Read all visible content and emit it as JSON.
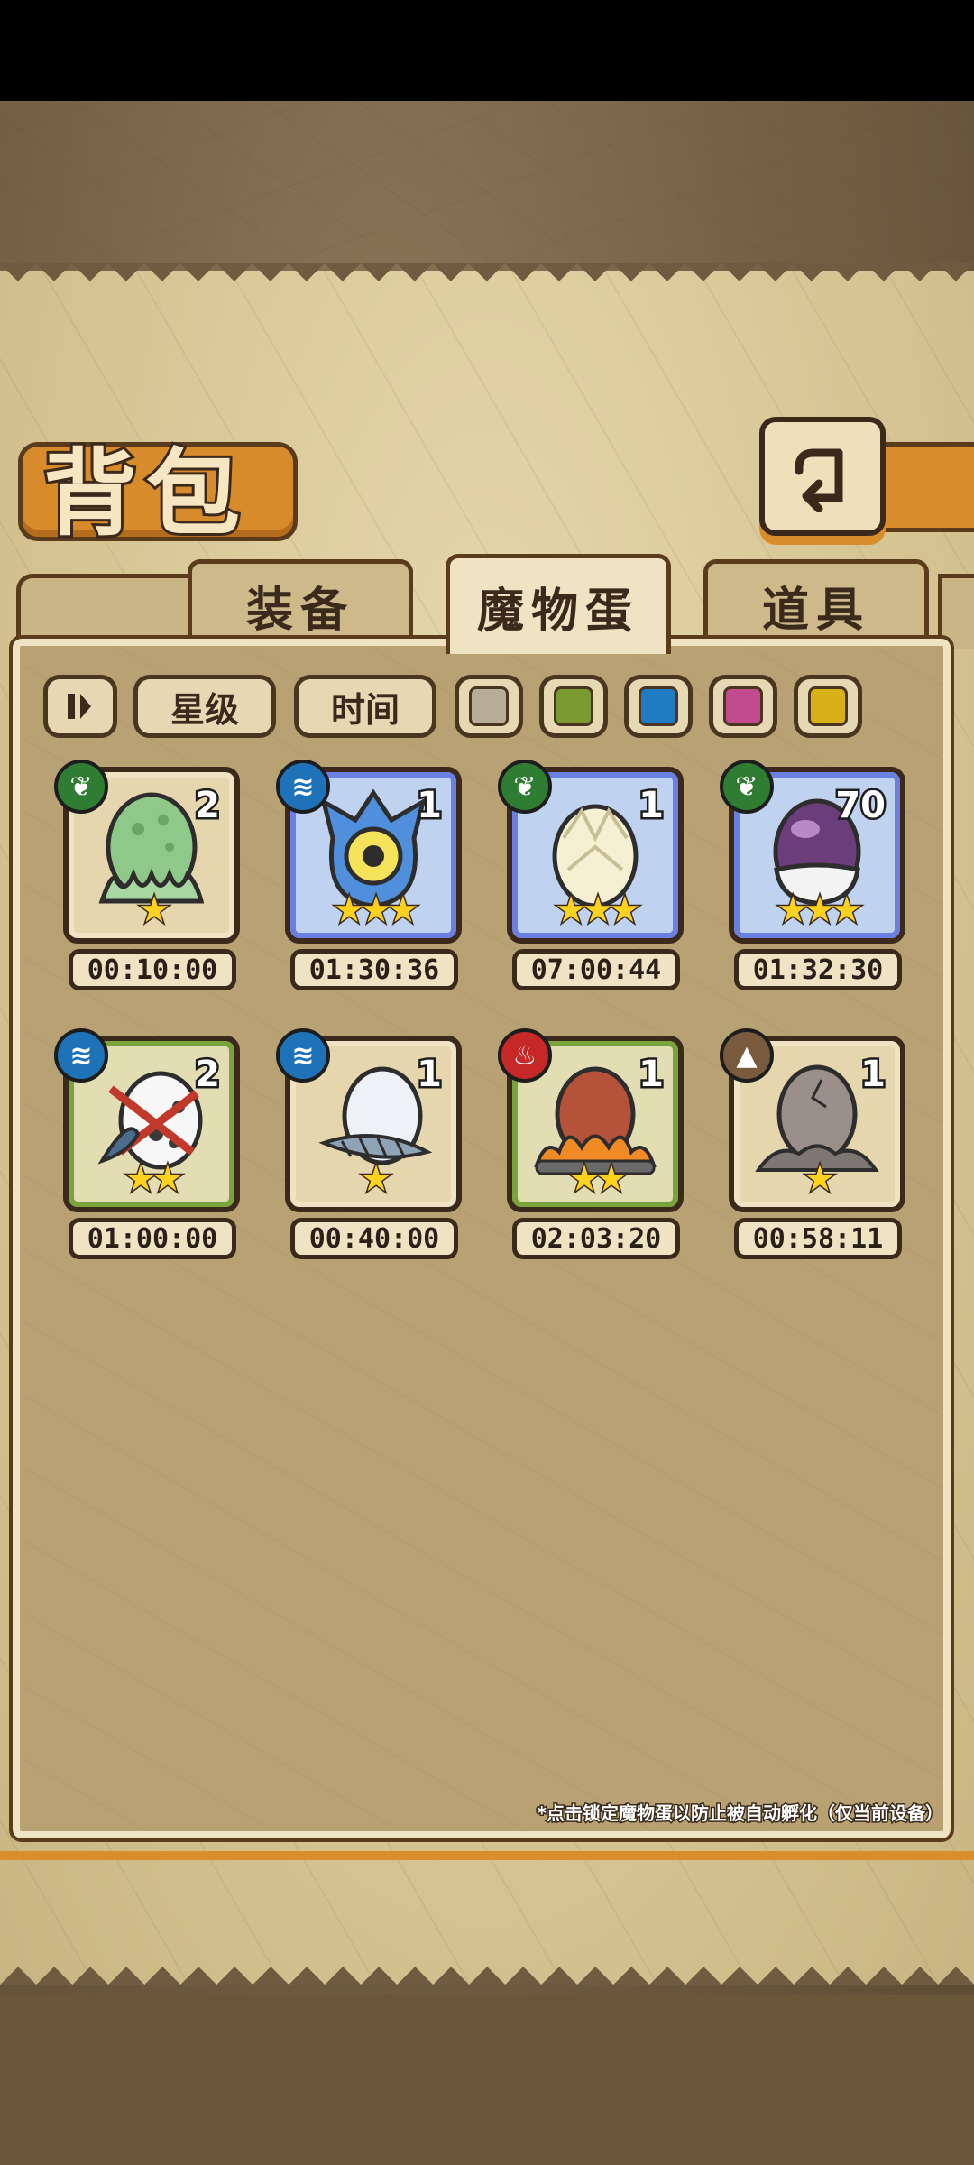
{
  "header": {
    "title": "背包",
    "back_icon": "return-arrow-icon"
  },
  "tabs": [
    {
      "label": "装备",
      "active": false
    },
    {
      "label": "魔物蛋",
      "active": true
    },
    {
      "label": "道具",
      "active": false
    }
  ],
  "filters": {
    "sort_icon": "sort-order-icon",
    "star_label": "星级",
    "time_label": "时间",
    "color_swatches": [
      "#b7ad98",
      "#7b9a2f",
      "#1f7cc2",
      "#c24a8e",
      "#d9b018"
    ]
  },
  "items": [
    {
      "element": "plant",
      "count": "2",
      "stars": "★",
      "timer": "00:10:00",
      "rarity": "grey",
      "egg": "green-slime-egg"
    },
    {
      "element": "water",
      "count": "1",
      "stars": "★★★",
      "timer": "01:30:36",
      "rarity": "blue",
      "egg": "blue-eye-egg"
    },
    {
      "element": "plant",
      "count": "1",
      "stars": "★★★",
      "timer": "07:00:44",
      "rarity": "blue",
      "egg": "crystal-egg"
    },
    {
      "element": "plant",
      "count": "70",
      "stars": "★★★",
      "timer": "01:32:30",
      "rarity": "blue",
      "egg": "purple-fur-egg"
    },
    {
      "element": "water",
      "count": "2",
      "stars": "★★",
      "timer": "01:00:00",
      "rarity": "green",
      "egg": "spotted-feather-egg"
    },
    {
      "element": "water",
      "count": "1",
      "stars": "★",
      "timer": "00:40:00",
      "rarity": "grey",
      "egg": "white-feather-egg"
    },
    {
      "element": "fire",
      "count": "1",
      "stars": "★★",
      "timer": "02:03:20",
      "rarity": "green",
      "egg": "fire-egg"
    },
    {
      "element": "earth",
      "count": "1",
      "stars": "★",
      "timer": "00:58:11",
      "rarity": "grey",
      "egg": "stone-egg"
    }
  ],
  "footer_note": "*点击锁定魔物蛋以防止被自动孵化（仅当前设备）"
}
